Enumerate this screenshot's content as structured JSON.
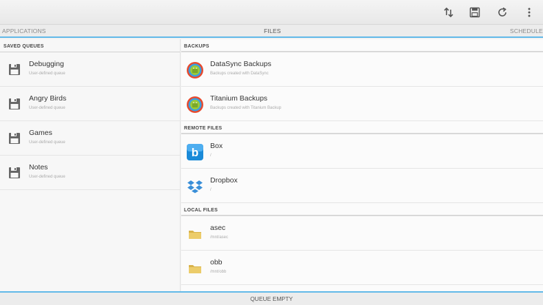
{
  "actionbar": {
    "icons": [
      "sort-icon",
      "save-icon",
      "refresh-icon",
      "overflow-menu-icon"
    ]
  },
  "tabs": {
    "applications": "APPLICATIONS",
    "files": "FILES",
    "schedule": "SCHEDULE"
  },
  "left": {
    "section_title": "SAVED QUEUES",
    "items": [
      {
        "title": "Debugging",
        "subtitle": "User-defined queue",
        "icon": "floppy-disk-icon"
      },
      {
        "title": "Angry Birds",
        "subtitle": "User-defined queue",
        "icon": "floppy-disk-icon"
      },
      {
        "title": "Games",
        "subtitle": "User-defined queue",
        "icon": "floppy-disk-icon"
      },
      {
        "title": "Notes",
        "subtitle": "User-defined queue",
        "icon": "floppy-disk-icon"
      }
    ]
  },
  "right": {
    "backups": {
      "section_title": "BACKUPS",
      "items": [
        {
          "title": "DataSync Backups",
          "subtitle": "Backups created with DataSync",
          "icon": "datasync-icon"
        },
        {
          "title": "Titanium Backups",
          "subtitle": "Backups created with Titanium Backup",
          "icon": "titanium-icon"
        }
      ]
    },
    "remote": {
      "section_title": "REMOTE FILES",
      "items": [
        {
          "title": "Box",
          "subtitle": "/",
          "icon": "box-icon"
        },
        {
          "title": "Dropbox",
          "subtitle": "/",
          "icon": "dropbox-icon"
        }
      ]
    },
    "local": {
      "section_title": "LOCAL FILES",
      "items": [
        {
          "title": "asec",
          "subtitle": "/mnt/asec",
          "icon": "folder-icon"
        },
        {
          "title": "obb",
          "subtitle": "/mnt/obb",
          "icon": "folder-icon"
        }
      ]
    }
  },
  "footer": {
    "status": "QUEUE EMPTY"
  },
  "colors": {
    "accent": "#5fb8e8",
    "box_blue": "#1a8ad8",
    "dropbox_blue": "#3a8fd8",
    "folder": "#e8c660"
  }
}
